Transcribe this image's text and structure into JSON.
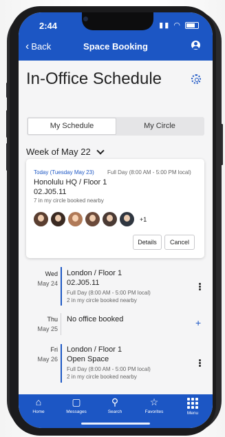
{
  "status": {
    "time": "2:44"
  },
  "nav": {
    "back_label": "Back",
    "title": "Space Booking"
  },
  "page": {
    "title": "In-Office Schedule"
  },
  "segments": {
    "active": "My Schedule",
    "inactive": "My Circle"
  },
  "week": {
    "label": "Week of May 22"
  },
  "today_card": {
    "date_label": "Today (Tuesday May 23)",
    "time_label": "Full Day (8:00 AM - 5:00 PM local)",
    "location": "Honolulu HQ / Floor 1",
    "room": "02.J05.11",
    "nearby": "7 in my circle booked nearby",
    "avatar_colors": [
      "#5a3e30",
      "#3a2a22",
      "#b07a58",
      "#6b4a3a",
      "#4a3a34",
      "#2f3640"
    ],
    "extra_count": "+1",
    "details_label": "Details",
    "cancel_label": "Cancel"
  },
  "schedule": [
    {
      "day": "Wed",
      "date": "May 24",
      "location": "London / Floor 1",
      "room": "02.J05.11",
      "time": "Full Day (8:00 AM - 5:00 PM local)",
      "nearby": "2 in my circle booked nearby"
    },
    {
      "day": "Thu",
      "date": "May 25",
      "empty_label": "No office booked"
    },
    {
      "day": "Fri",
      "date": "May 26",
      "location": "London / Floor 1",
      "room": "Open Space",
      "time": "Full Day (8:00 AM - 5:00 PM local)",
      "nearby": "2 in my circle booked nearby"
    }
  ],
  "tabs": [
    {
      "label": "Home",
      "icon": "home-icon"
    },
    {
      "label": "Messages",
      "icon": "chat-icon"
    },
    {
      "label": "Search",
      "icon": "search-icon"
    },
    {
      "label": "Favorites",
      "icon": "star-icon"
    },
    {
      "label": "Menu",
      "icon": "grid-icon"
    }
  ],
  "colors": {
    "brand": "#1c56c4",
    "background": "#f5f5f6"
  }
}
